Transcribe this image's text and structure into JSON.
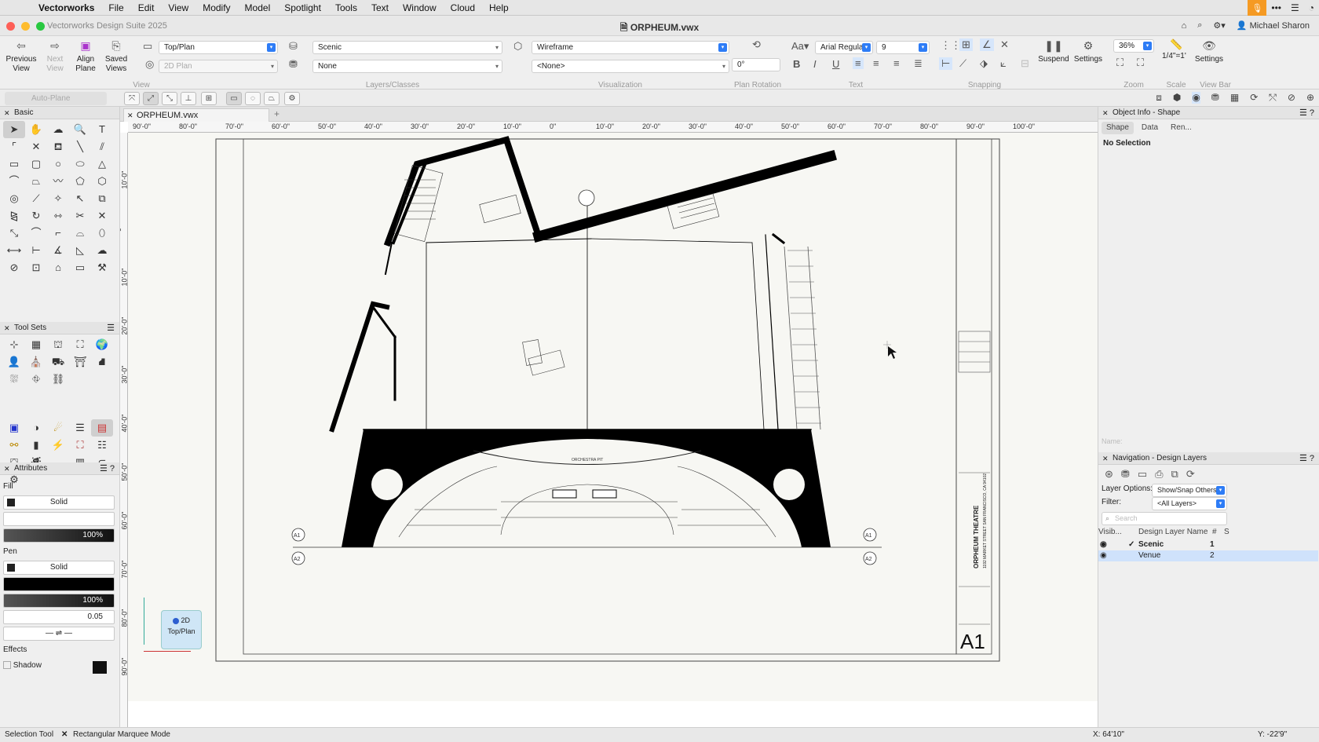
{
  "menubar": {
    "app": "Vectorworks",
    "items": [
      "File",
      "Edit",
      "View",
      "Modify",
      "Model",
      "Spotlight",
      "Tools",
      "Text",
      "Window",
      "Cloud",
      "Help"
    ]
  },
  "titlebar": {
    "suite": "Vectorworks Design Suite 2025",
    "document": "ORPHEUM.vwx",
    "user": "Michael Sharon"
  },
  "toolbar": {
    "previous_view": "Previous View",
    "next_view": "Next View",
    "align_plane": "Align Plane",
    "saved_views": "Saved Views",
    "view_value": "Top/Plan",
    "projection_value": "2D Plan",
    "class_value": "Scenic",
    "layer_value": "None",
    "render_value": "Wireframe",
    "background_value": "<None>",
    "rotation_value": "0°",
    "font_value": "Arial Regular",
    "size_value": "9",
    "suspend": "Suspend",
    "settings": "Settings",
    "zoom_value": "36%",
    "scale_value": "1/4\"=1'",
    "viewbar_settings": "Settings",
    "groups": {
      "view": "View",
      "layers_classes": "Layers/Classes",
      "visualization": "Visualization",
      "plan_rotation": "Plan Rotation",
      "text": "Text",
      "snapping": "Snapping",
      "zoom": "Zoom",
      "scale": "Scale",
      "view_bar": "View Bar"
    }
  },
  "modebar": {
    "auto_plane": "Auto-Plane"
  },
  "left_panel": {
    "basic_title": "Basic",
    "toolsets_title": "Tool Sets",
    "attributes_title": "Attributes",
    "fill_label": "Fill",
    "fill_value": "Solid",
    "fill_opacity": "100%",
    "pen_label": "Pen",
    "pen_value": "Solid",
    "pen_opacity": "100%",
    "thickness": "0.05",
    "effects_label": "Effects",
    "shadow_label": "Shadow"
  },
  "canvas": {
    "tab_title": "ORPHEUM.vwx",
    "h_ruler": [
      "90'-0\"",
      "80'-0\"",
      "70'-0\"",
      "60'-0\"",
      "50'-0\"",
      "40'-0\"",
      "30'-0\"",
      "20'-0\"",
      "10'-0\"",
      "0\"",
      "10'-0\"",
      "20'-0\"",
      "30'-0\"",
      "40'-0\"",
      "50'-0\"",
      "60'-0\"",
      "70'-0\"",
      "80'-0\"",
      "90'-0\"",
      "100'-0\""
    ],
    "v_ruler": [
      "10'-0\"",
      "0\"",
      "10'-0\"",
      "20'-0\"",
      "30'-0\"",
      "40'-0\"",
      "50'-0\"",
      "60'-0\"",
      "70'-0\"",
      "80'-0\"",
      "90'-0\""
    ],
    "orchestra_pit": "ORCHESTRA PIT",
    "sheet_title": "ORPHEUM THEATRE",
    "sheet_address": "1192 MARKET STREET SAN FRANCISCO, CA 94102",
    "sheet_number": "A1",
    "marker_a1": "A1",
    "marker_a2": "A2",
    "view_badge_mode": "2D",
    "view_badge_label": "Top/Plan"
  },
  "right_panel": {
    "oip_title": "Object Info - Shape",
    "tabs": [
      "Shape",
      "Data",
      "Ren..."
    ],
    "selection": "No Selection",
    "name_placeholder": "Name:",
    "nav_title": "Navigation - Design Layers",
    "layer_options_label": "Layer Options:",
    "layer_options_value": "Show/Snap Others",
    "filter_label": "Filter:",
    "filter_value": "<All Layers>",
    "search_placeholder": "Search",
    "columns": {
      "visibility": "Visib...",
      "name": "Design Layer Name",
      "num": "#",
      "s": "S"
    },
    "layers": [
      {
        "name": "Scenic",
        "num": "1"
      },
      {
        "name": "Venue",
        "num": "2"
      }
    ]
  },
  "status": {
    "tool": "Selection Tool",
    "mode": "Rectangular Marquee Mode",
    "x": "X: 64'10\"",
    "y": "Y: -22'9\""
  }
}
